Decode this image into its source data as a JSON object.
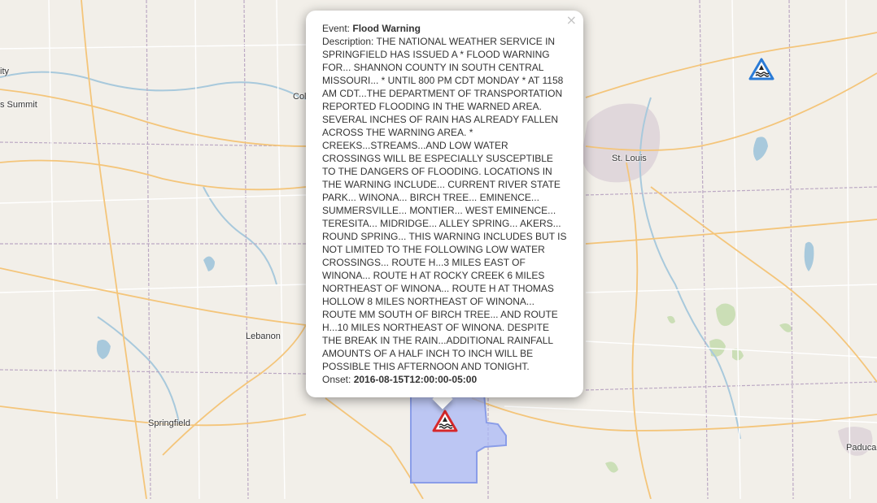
{
  "map": {
    "labels": {
      "kansas_city_fragment": "ity",
      "lees_summit_fragment": "s Summit",
      "columbia_fragment": "Col",
      "st_louis": "St. Louis",
      "lebanon": "Lebanon",
      "springfield": "Springfield",
      "paducah_fragment": "Paduca"
    },
    "colors": {
      "background": "#f2efe9",
      "warning_polygon_fill": "#a9b8f5",
      "warning_polygon_stroke": "#8a9de8",
      "primary_road": "#f4c57a",
      "minor_road": "#ffffff",
      "boundary": "#bca9c4",
      "water": "#a8c9dc",
      "forest": "#c7ddb1",
      "urban": "#ddd2d8"
    },
    "markers": [
      {
        "icon": "flood-warning-icon",
        "color": "#d6282b"
      },
      {
        "icon": "flood-watch-icon",
        "color": "#2b7bd6"
      }
    ]
  },
  "popup": {
    "close_label": "×",
    "event_label": "Event:",
    "event_value": "Flood Warning",
    "description_label": "Description:",
    "description_value": "THE NATIONAL WEATHER SERVICE IN SPRINGFIELD HAS ISSUED A * FLOOD WARNING FOR... SHANNON COUNTY IN SOUTH CENTRAL MISSOURI... * UNTIL 800 PM CDT MONDAY * AT 1158 AM CDT...THE DEPARTMENT OF TRANSPORTATION REPORTED FLOODING IN THE WARNED AREA. SEVERAL INCHES OF RAIN HAS ALREADY FALLEN ACROSS THE WARNING AREA. * CREEKS...STREAMS...AND LOW WATER CROSSINGS WILL BE ESPECIALLY SUSCEPTIBLE TO THE DANGERS OF FLOODING. LOCATIONS IN THE WARNING INCLUDE... CURRENT RIVER STATE PARK... WINONA... BIRCH TREE... EMINENCE... SUMMERSVILLE... MONTIER... WEST EMINENCE... TERESITA... MIDRIDGE... ALLEY SPRING... AKERS... ROUND SPRING... THIS WARNING INCLUDES BUT IS NOT LIMITED TO THE FOLLOWING LOW WATER CROSSINGS... ROUTE H...3 MILES EAST OF WINONA... ROUTE H AT ROCKY CREEK 6 MILES NORTHEAST OF WINONA... ROUTE H AT THOMAS HOLLOW 8 MILES NORTHEAST OF WINONA... ROUTE MM SOUTH OF BIRCH TREE... AND ROUTE H...10 MILES NORTHEAST OF WINONA. DESPITE THE BREAK IN THE RAIN...ADDITIONAL RAINFALL AMOUNTS OF A HALF INCH TO INCH WILL BE POSSIBLE THIS AFTERNOON AND TONIGHT.",
    "onset_label": "Onset:",
    "onset_value": "2016-08-15T12:00:00-05:00"
  }
}
